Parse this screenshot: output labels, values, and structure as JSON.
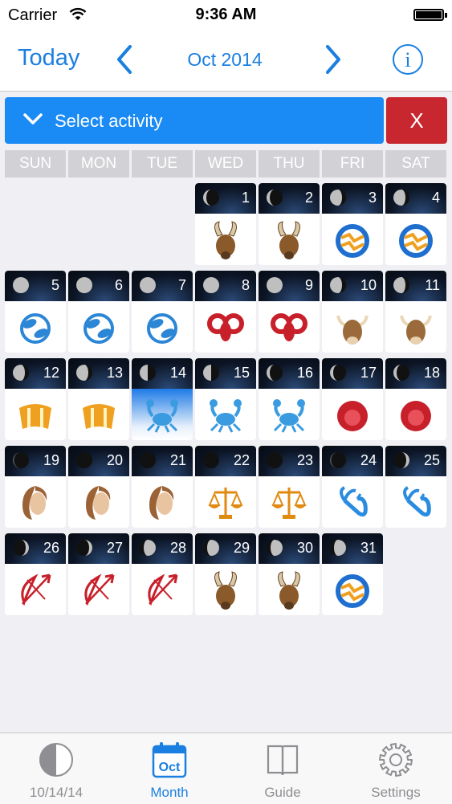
{
  "status_bar": {
    "carrier": "Carrier",
    "time": "9:36 AM"
  },
  "nav": {
    "today_label": "Today",
    "month_label": "Oct 2014",
    "info_label": "i"
  },
  "activity": {
    "select_label": "Select activity",
    "clear_label": "X"
  },
  "weekdays": [
    "SUN",
    "MON",
    "TUE",
    "WED",
    "THU",
    "FRI",
    "SAT"
  ],
  "calendar": {
    "first_weekday": 3,
    "today": 14,
    "days": [
      {
        "d": "1",
        "moon": "waning-crescent",
        "sign": "capricorn"
      },
      {
        "d": "2",
        "moon": "waning-crescent",
        "sign": "capricorn"
      },
      {
        "d": "3",
        "moon": "waning-gibbous",
        "sign": "aquarius"
      },
      {
        "d": "4",
        "moon": "waning-gibbous",
        "sign": "aquarius"
      },
      {
        "d": "5",
        "moon": "full",
        "sign": "pisces"
      },
      {
        "d": "6",
        "moon": "full",
        "sign": "pisces"
      },
      {
        "d": "7",
        "moon": "full",
        "sign": "pisces"
      },
      {
        "d": "8",
        "moon": "full",
        "sign": "aries"
      },
      {
        "d": "9",
        "moon": "full",
        "sign": "aries"
      },
      {
        "d": "10",
        "moon": "waning-gibbous",
        "sign": "taurus"
      },
      {
        "d": "11",
        "moon": "waning-gibbous",
        "sign": "taurus"
      },
      {
        "d": "12",
        "moon": "waning-gibbous",
        "sign": "gemini"
      },
      {
        "d": "13",
        "moon": "waning-gibbous",
        "sign": "gemini"
      },
      {
        "d": "14",
        "moon": "half",
        "sign": "cancer"
      },
      {
        "d": "15",
        "moon": "half",
        "sign": "cancer"
      },
      {
        "d": "16",
        "moon": "waning-crescent",
        "sign": "cancer"
      },
      {
        "d": "17",
        "moon": "waning-crescent",
        "sign": "leo"
      },
      {
        "d": "18",
        "moon": "waning-crescent",
        "sign": "leo"
      },
      {
        "d": "19",
        "moon": "thin-crescent",
        "sign": "virgo"
      },
      {
        "d": "20",
        "moon": "new",
        "sign": "virgo"
      },
      {
        "d": "21",
        "moon": "new",
        "sign": "virgo"
      },
      {
        "d": "22",
        "moon": "new",
        "sign": "libra"
      },
      {
        "d": "23",
        "moon": "new",
        "sign": "libra"
      },
      {
        "d": "24",
        "moon": "thin-crescent",
        "sign": "scorpio"
      },
      {
        "d": "25",
        "moon": "waxing-crescent",
        "sign": "scorpio"
      },
      {
        "d": "26",
        "moon": "waxing-crescent",
        "sign": "sagittarius"
      },
      {
        "d": "27",
        "moon": "waxing-crescent",
        "sign": "sagittarius"
      },
      {
        "d": "28",
        "moon": "waxing-gibbous",
        "sign": "sagittarius"
      },
      {
        "d": "29",
        "moon": "waxing-gibbous",
        "sign": "capricorn"
      },
      {
        "d": "30",
        "moon": "waxing-gibbous",
        "sign": "capricorn"
      },
      {
        "d": "31",
        "moon": "waxing-gibbous",
        "sign": "aquarius"
      }
    ]
  },
  "sign_colors": {
    "capricorn": "#8b5a2b",
    "aquarius": "#1e6fd0",
    "pisces": "#2b86d6",
    "aries": "#c8202a",
    "taurus": "#9a6a3a",
    "gemini": "#f0a020",
    "cancer": "#3a9be0",
    "leo": "#c8202a",
    "virgo": "#9a6235",
    "libra": "#e08a10",
    "scorpio": "#2a8ce0",
    "sagittarius": "#c8202a"
  },
  "tabs": [
    {
      "label": "10/14/14",
      "icon": "moon-phase-icon",
      "active": false
    },
    {
      "label": "Month",
      "icon": "calendar-icon",
      "active": true,
      "icon_text": "Oct"
    },
    {
      "label": "Guide",
      "icon": "book-icon",
      "active": false
    },
    {
      "label": "Settings",
      "icon": "gear-icon",
      "active": false
    }
  ],
  "accent_color": "#1a7fe0"
}
